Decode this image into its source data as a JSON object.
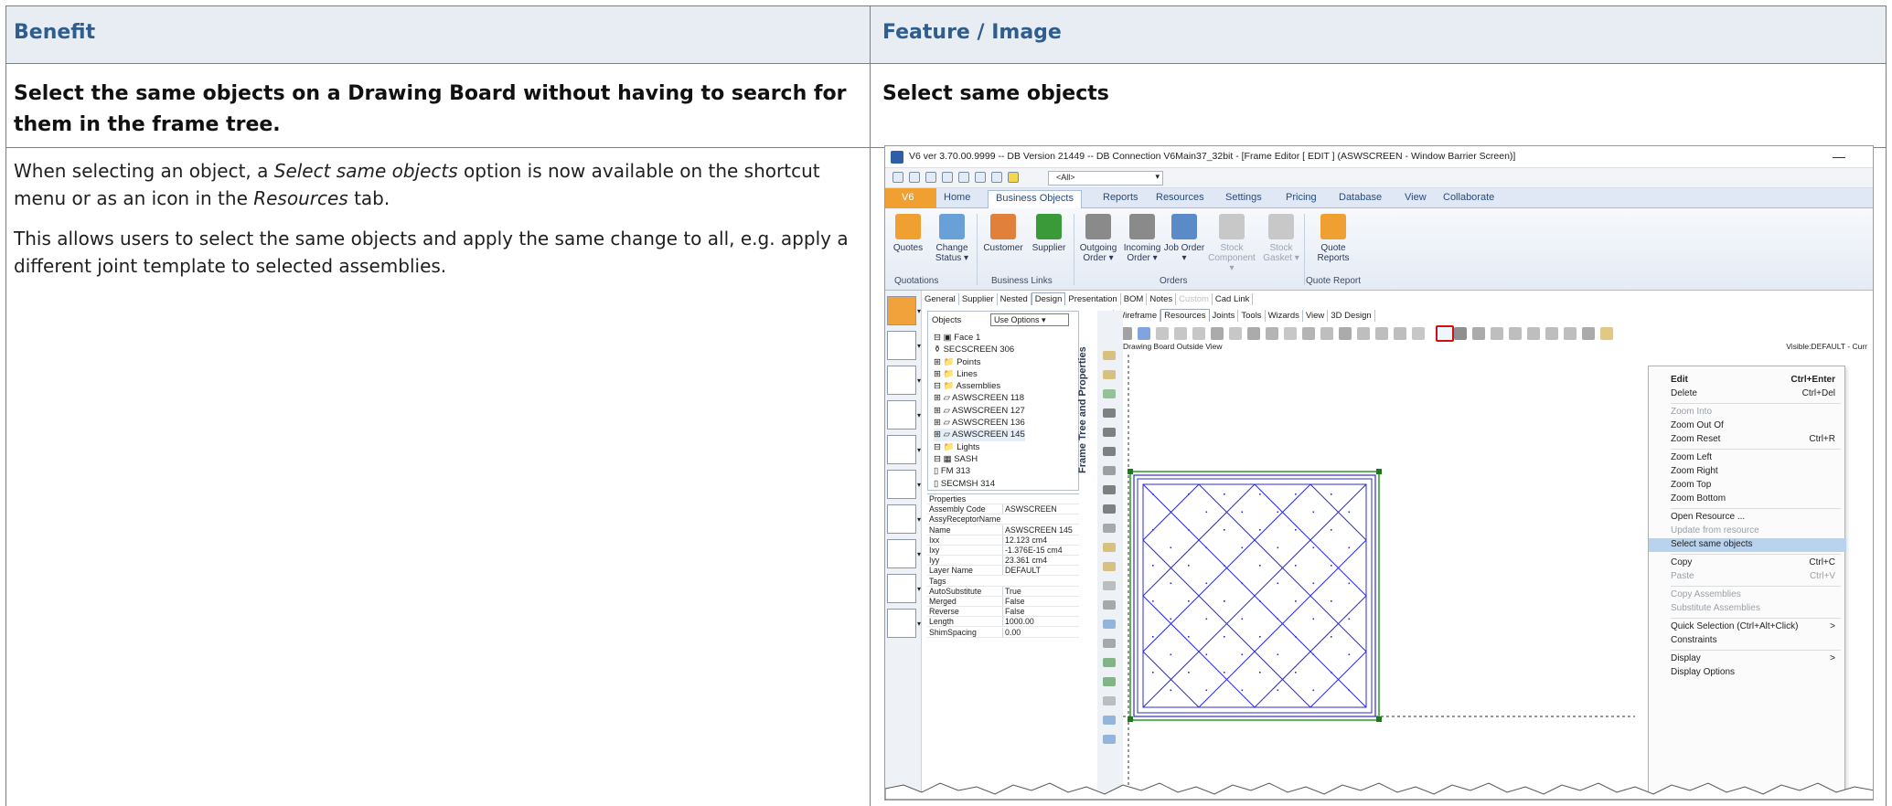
{
  "table": {
    "header_left": "Benefit",
    "header_right": "Feature / Image",
    "title_left": "Select the same objects on a Drawing Board without having to search for them in the frame tree.",
    "title_right": "Select same objects",
    "body_p1_a": "When selecting an object, a ",
    "body_p1_em1": "Select same objects",
    "body_p1_b": " option is now available on the shortcut menu or as an icon in the ",
    "body_p1_em2": "Resources",
    "body_p1_c": " tab.",
    "body_p2": "This allows users to select the same objects and apply the same change to all, e.g. apply a different joint template to selected assemblies."
  },
  "app": {
    "window_title": "V6 ver 3.70.00.9999 -- DB Version 21449 -- DB Connection V6Main37_32bit - [Frame Editor  [ EDIT ] (ASWSCREEN - Window Barrier Screen)]",
    "minimize": "—",
    "qat_combo": "<All>",
    "ribbon_tabs": [
      "V6",
      "Home",
      "Business Objects",
      "Reports",
      "Resources",
      "Settings",
      "Pricing",
      "Database",
      "View",
      "Collaborate"
    ],
    "ribbon_buttons": [
      {
        "label": "Quotes",
        "color": "#f0a030"
      },
      {
        "label": "Change Status ▾",
        "color": "#6aa0d8"
      },
      {
        "label": "Customer",
        "color": "#e0803a"
      },
      {
        "label": "Supplier",
        "color": "#3a9a3a"
      },
      {
        "label": "Outgoing Order ▾",
        "color": "#8a8a8a"
      },
      {
        "label": "Incoming Order ▾",
        "color": "#8a8a8a"
      },
      {
        "label": "Job Order ▾",
        "color": "#5a8ac8"
      },
      {
        "label": "Stock Component ▾",
        "color": "#c8c8c8"
      },
      {
        "label": "Stock Gasket ▾",
        "color": "#c8c8c8"
      },
      {
        "label": "Quote Reports",
        "color": "#f0a030"
      }
    ],
    "ribbon_groups": [
      "Quotations",
      "Business Links",
      "Orders",
      "Quote Report"
    ],
    "subtabs": [
      "General",
      "Supplier",
      "Nested",
      "Design",
      "Presentation",
      "BOM",
      "Notes",
      "Custom",
      "Cad Link"
    ],
    "objects_label": "Objects",
    "objects_select": "Use Options",
    "tree": [
      "⊟ ▣ Face 1",
      "      ⚱ SECSCREEN 306",
      "   ⊞ 📁 Points",
      "   ⊞ 📁 Lines",
      "   ⊟ 📁 Assemblies",
      "      ⊞ ▱ ASWSCREEN 118",
      "      ⊞ ▱ ASWSCREEN 127",
      "      ⊞ ▱ ASWSCREEN 136",
      "      ⊞ ▱ ASWSCREEN 145",
      "   ⊟ 📁 Lights",
      "      ⊟ ▦ SASH",
      "         ▯ FM 313",
      "         ▯ SECMSH 314"
    ],
    "properties": [
      {
        "k": "Properties",
        "v": ""
      },
      {
        "k": "Assembly Code",
        "v": "ASWSCREEN"
      },
      {
        "k": "AssyReceptorName",
        "v": ""
      },
      {
        "k": "Name",
        "v": "ASWSCREEN 145"
      },
      {
        "k": "Ixx",
        "v": "12.123 cm4"
      },
      {
        "k": "Ixy",
        "v": "-1.376E-15 cm4"
      },
      {
        "k": "Iyy",
        "v": "23.361 cm4"
      },
      {
        "k": "Layer Name",
        "v": "DEFAULT"
      },
      {
        "k": "Tags",
        "v": ""
      },
      {
        "k": "AutoSubstitute",
        "v": "True"
      },
      {
        "k": "Merged",
        "v": "False"
      },
      {
        "k": "Reverse",
        "v": "False"
      },
      {
        "k": "Length",
        "v": "1000.00"
      },
      {
        "k": "ShimSpacing",
        "v": "0.00"
      }
    ],
    "vertical_label": "Frame Tree and Properties",
    "resource_tabs": [
      "Wireframe",
      "Resources",
      "Joints",
      "Tools",
      "Wizards",
      "View",
      "3D Design"
    ],
    "drawing_board_title": "Drawing Board Outside View",
    "drawing_board_right": "Visible:DEFAULT - Curr",
    "context_menu": [
      {
        "label": "Edit",
        "shortcut": "Ctrl+Enter",
        "state": "bold"
      },
      {
        "label": "Delete",
        "shortcut": "Ctrl+Del",
        "state": ""
      },
      {
        "label": "Zoom Into",
        "shortcut": "",
        "state": "dim"
      },
      {
        "label": "Zoom Out Of",
        "shortcut": "",
        "state": ""
      },
      {
        "label": "Zoom Reset",
        "shortcut": "Ctrl+R",
        "state": ""
      },
      {
        "label": "Zoom Left",
        "shortcut": "",
        "state": ""
      },
      {
        "label": "Zoom Right",
        "shortcut": "",
        "state": ""
      },
      {
        "label": "Zoom Top",
        "shortcut": "",
        "state": ""
      },
      {
        "label": "Zoom Bottom",
        "shortcut": "",
        "state": ""
      },
      {
        "label": "Open Resource ...",
        "shortcut": "",
        "state": ""
      },
      {
        "label": "Update from resource",
        "shortcut": "",
        "state": "dim"
      },
      {
        "label": "Select same objects",
        "shortcut": "",
        "state": "sel"
      },
      {
        "label": "Copy",
        "shortcut": "Ctrl+C",
        "state": ""
      },
      {
        "label": "Paste",
        "shortcut": "Ctrl+V",
        "state": "dim"
      },
      {
        "label": "Copy Assemblies",
        "shortcut": "",
        "state": "dim"
      },
      {
        "label": "Substitute Assemblies",
        "shortcut": "",
        "state": "dim"
      },
      {
        "label": "Quick Selection (Ctrl+Alt+Click)",
        "shortcut": ">",
        "state": ""
      },
      {
        "label": "Constraints",
        "shortcut": "",
        "state": ""
      },
      {
        "label": "Display",
        "shortcut": ">",
        "state": ""
      },
      {
        "label": "Display Options",
        "shortcut": "",
        "state": ""
      }
    ],
    "colors": {
      "accent": "#2e5d8e",
      "ribbon_orange": "#f0a030",
      "frame_blue": "#2b2bd6",
      "highlight_red": "#d01010",
      "menu_select": "#b9d3ef"
    }
  }
}
